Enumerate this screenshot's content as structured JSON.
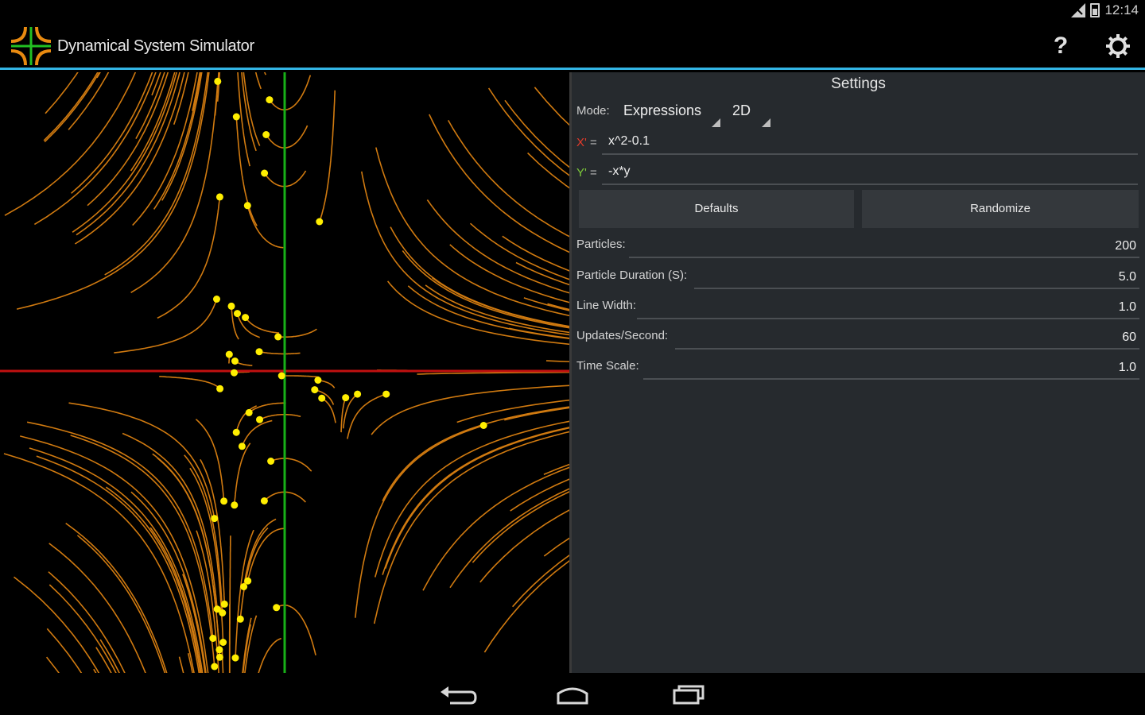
{
  "status": {
    "time": "12:14"
  },
  "app": {
    "title": "Dynamical System Simulator"
  },
  "actions": {
    "help_label": "?"
  },
  "settings": {
    "title": "Settings",
    "mode_label": "Mode:",
    "mode_value": "Expressions",
    "dimension_value": "2D",
    "x_label": "X'",
    "y_label": "Y'",
    "eq_sign": "=",
    "x_expr": "x^2-0.1",
    "y_expr": "-x*y",
    "defaults_button": "Defaults",
    "randomize_button": "Randomize",
    "params": [
      {
        "label": "Particles:",
        "value": "200"
      },
      {
        "label": "Particle Duration (S):",
        "value": "5.0"
      },
      {
        "label": "Line Width:",
        "value": "1.0"
      },
      {
        "label": "Updates/Second:",
        "value": "60"
      },
      {
        "label": "Time Scale:",
        "value": "1.0"
      }
    ]
  },
  "colors": {
    "accent": "#33b5e5",
    "x_axis": "#c01010",
    "y_axis": "#18b018",
    "trail": "#d07a10",
    "particle": "#ffee00"
  },
  "icons": [
    "app-logo-icon",
    "help-icon",
    "settings-gear-icon",
    "back-icon",
    "home-icon",
    "recents-icon"
  ]
}
